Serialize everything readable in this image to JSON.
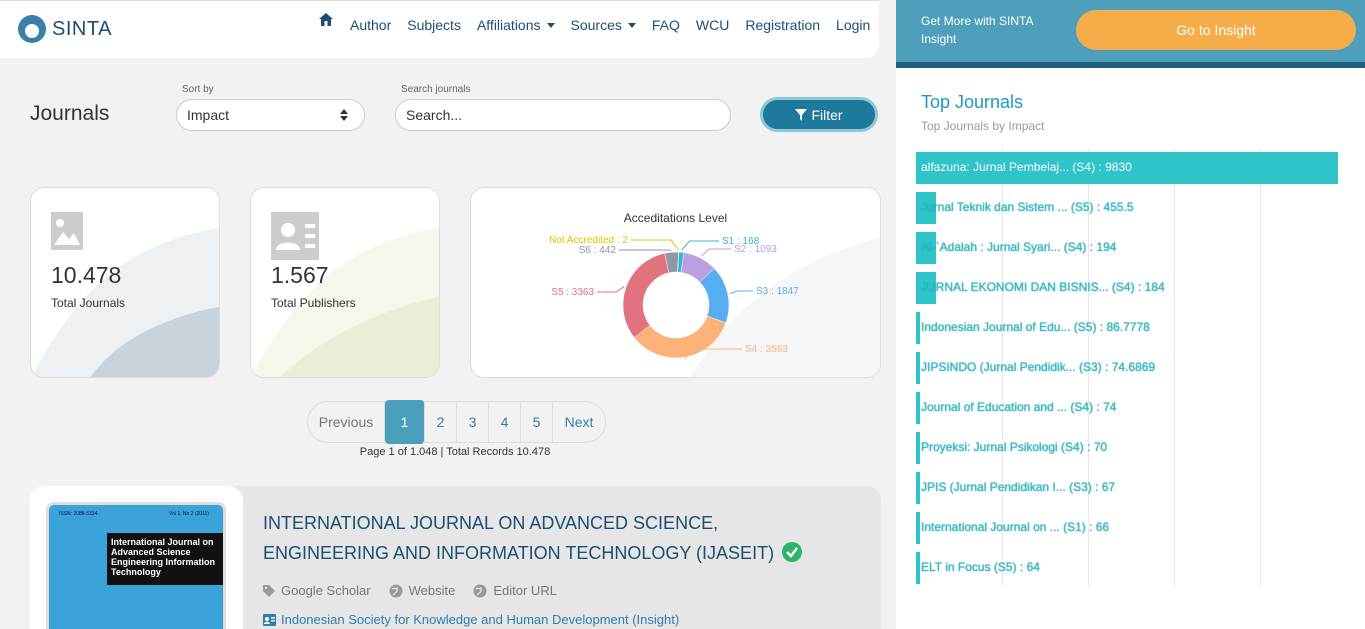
{
  "navbar": {
    "brand": "SINTA",
    "items": [
      {
        "label": "Author"
      },
      {
        "label": "Subjects"
      },
      {
        "label": "Affiliations",
        "dropdown": true
      },
      {
        "label": "Sources",
        "dropdown": true
      },
      {
        "label": "FAQ"
      },
      {
        "label": "WCU"
      },
      {
        "label": "Registration"
      },
      {
        "label": "Login"
      }
    ]
  },
  "promo": {
    "text": "Get More with SINTA Insight",
    "button": "Go to Insight"
  },
  "page": {
    "title": "Journals",
    "sort_label": "Sort by",
    "sort_value": "Impact",
    "search_label": "Search journals",
    "search_placeholder": "Search...",
    "filter_button": "Filter"
  },
  "stats": {
    "journals": {
      "value": "10.478",
      "label": "Total Journals",
      "icon": "image-icon"
    },
    "publishers": {
      "value": "1.567",
      "label": "Total Publishers",
      "icon": "id-card-icon"
    }
  },
  "chart_data": {
    "type": "pie",
    "title": "Acceditations Level",
    "donut": true,
    "slices": [
      {
        "label": "S1 : 168",
        "name": "S1",
        "value": 168,
        "color": "#36b5d8"
      },
      {
        "label": "S2 : 1093",
        "name": "S2",
        "value": 1093,
        "color": "#b9a0e0"
      },
      {
        "label": "S3 : 1847",
        "name": "S3",
        "value": 1847,
        "color": "#56aef0"
      },
      {
        "label": "S4 : 3563",
        "name": "S4",
        "value": 3563,
        "color": "#fdb27a"
      },
      {
        "label": "S5 : 3363",
        "name": "S5",
        "value": 3363,
        "color": "#e0737d"
      },
      {
        "label": "S6 : 442",
        "name": "S6",
        "value": 442,
        "color": "#8f96a6"
      },
      {
        "label": "Not Accredited : 2",
        "name": "Not Accredited",
        "value": 2,
        "color": "#e6c200"
      }
    ]
  },
  "pagination": {
    "prev": "Previous",
    "pages": [
      "1",
      "2",
      "3",
      "4",
      "5"
    ],
    "active": "1",
    "next": "Next",
    "info": "Page 1 of 1.048 | Total Records 10.478"
  },
  "journal": {
    "title": "INTERNATIONAL JOURNAL ON ADVANCED SCIENCE, ENGINEERING AND INFORMATION TECHNOLOGY (IJASEIT)",
    "links": [
      "Google Scholar",
      "Website",
      "Editor URL"
    ],
    "publisher": "Indonesian Society for Knowledge and Human Development (Insight)",
    "thumb_title": "International Journal on Advanced Science Engineering Information Technology",
    "thumb_issn": "ISSN: 2088-5334",
    "thumb_vol": "Vol 1, No 2 (2011)"
  },
  "top_journals": {
    "title": "Top Journals",
    "subtitle": "Top Journals by Impact",
    "items": [
      {
        "label": "alfazuna: Jurnal Pembelaj... (S4) : 9830",
        "value": 9830
      },
      {
        "label": "Jurnal Teknik dan Sistem ... (S5) : 455.5",
        "value": 455.5
      },
      {
        "label": "Al-`Adalah : Jurnal Syari... (S4) : 194",
        "value": 194
      },
      {
        "label": "JURNAL EKONOMI DAN BISNIS... (S4) : 184",
        "value": 184
      },
      {
        "label": "Indonesian Journal of Edu... (S5) : 86.7778",
        "value": 86.7778
      },
      {
        "label": "JIPSINDO (Jurnal Pendidik... (S3) : 74.6869",
        "value": 74.6869
      },
      {
        "label": "Journal of Education and ... (S4) : 74",
        "value": 74
      },
      {
        "label": "Proyeksi: Jurnal Psikologi (S4) : 70",
        "value": 70
      },
      {
        "label": "JPIS (Jurnal Pendidikan I... (S3) : 67",
        "value": 67
      },
      {
        "label": "International Journal on ... (S1) : 66",
        "value": 66
      },
      {
        "label": "ELT in Focus (S5) : 64",
        "value": 64
      }
    ]
  }
}
